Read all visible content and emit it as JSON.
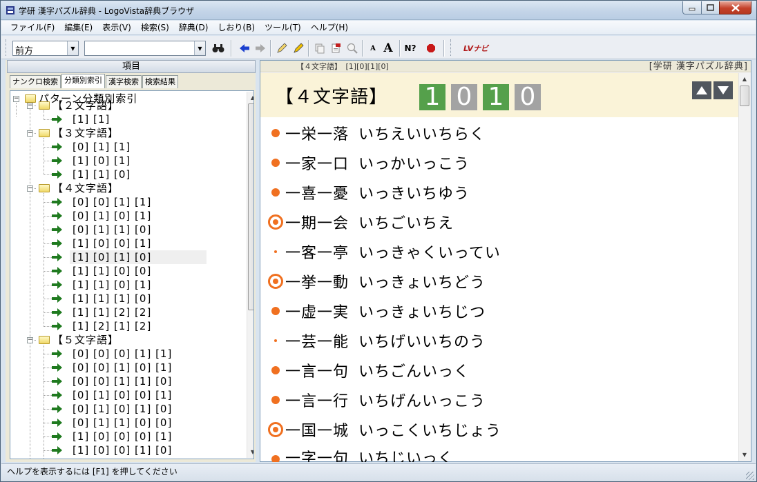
{
  "window": {
    "title": "学研 漢字パズル辞典 - LogoVista辞典ブラウザ"
  },
  "menu": [
    "ファイル(F)",
    "編集(E)",
    "表示(V)",
    "検索(S)",
    "辞典(D)",
    "しおり(B)",
    "ツール(T)",
    "ヘルプ(H)"
  ],
  "toolbar": {
    "search_mode": "前方",
    "search_input": "",
    "icons": [
      "binoculars-icon",
      "back-arrow-icon",
      "forward-arrow-icon",
      "pencil-icon",
      "highlighter-icon",
      "copy-icon",
      "cut-icon",
      "zoom-icon",
      "font-small-icon",
      "font-large-icon",
      "help-cursor-icon",
      "stop-icon",
      "lv-navi-icon"
    ],
    "font_small": "A",
    "font_large": "A",
    "help": "N?",
    "lv_navi": "LVナビ"
  },
  "left_panel": {
    "header": "項目",
    "tabs": [
      "ナンクロ検索",
      "分類別索引",
      "漢字検索",
      "検索結果"
    ],
    "active_tab": 1,
    "tree": {
      "root": "パターン分類別索引",
      "groups": [
        {
          "label": "【２文字語】",
          "items": [
            "[1]  [1]"
          ]
        },
        {
          "label": "【３文字語】",
          "items": [
            "[0]  [1]  [1]",
            "[1]  [0]  [1]",
            "[1]  [1]  [0]"
          ]
        },
        {
          "label": "【４文字語】",
          "items": [
            "[0]  [0]  [1]  [1]",
            "[0]  [1]  [0]  [1]",
            "[0]  [1]  [1]  [0]",
            "[1]  [0]  [0]  [1]",
            "[1]  [0]  [1]  [0]",
            "[1]  [1]  [0]  [0]",
            "[1]  [1]  [0]  [1]",
            "[1]  [1]  [1]  [0]",
            "[1]  [1]  [2]  [2]",
            "[1]  [2]  [1]  [2]"
          ]
        },
        {
          "label": "【５文字語】",
          "items": [
            "[0]  [0]  [0]  [1]  [1]",
            "[0]  [0]  [1]  [0]  [1]",
            "[0]  [0]  [1]  [1]  [0]",
            "[0]  [1]  [0]  [0]  [1]",
            "[0]  [1]  [0]  [1]  [0]",
            "[0]  [1]  [1]  [0]  [0]",
            "[1]  [0]  [0]  [0]  [1]",
            "[1]  [0]  [0]  [1]  [0]"
          ]
        }
      ],
      "selected": "[1]  [0]  [1]  [0]"
    }
  },
  "right_panel": {
    "crumb": "【４文字語】　[1][0][1][0]",
    "dict_name": "[学研 漢字パズル辞典]",
    "entry_title": "【４文字語】",
    "digits": [
      {
        "value": "1",
        "color": "#55a04b"
      },
      {
        "value": "0",
        "color": "#a3a3a3"
      },
      {
        "value": "1",
        "color": "#55a04b"
      },
      {
        "value": "0",
        "color": "#a3a3a3"
      }
    ],
    "entries": [
      {
        "mark": "dot",
        "word": "一栄一落",
        "reading": "いちえいいちらく"
      },
      {
        "mark": "dot",
        "word": "一家一口",
        "reading": "いっかいっこう"
      },
      {
        "mark": "dot",
        "word": "一喜一憂",
        "reading": "いっきいちゆう"
      },
      {
        "mark": "double",
        "word": "一期一会",
        "reading": "いちごいちえ"
      },
      {
        "mark": "small",
        "word": "一客一亭",
        "reading": "いっきゃくいってい"
      },
      {
        "mark": "double",
        "word": "一挙一動",
        "reading": "いっきょいちどう"
      },
      {
        "mark": "dot",
        "word": "一虚一実",
        "reading": "いっきょいちじつ"
      },
      {
        "mark": "small",
        "word": "一芸一能",
        "reading": "いちげいいちのう"
      },
      {
        "mark": "dot",
        "word": "一言一句",
        "reading": "いちごんいっく"
      },
      {
        "mark": "dot",
        "word": "一言一行",
        "reading": "いちげんいっこう"
      },
      {
        "mark": "double",
        "word": "一国一城",
        "reading": "いっこくいちじょう"
      },
      {
        "mark": "dot",
        "word": "一字一句",
        "reading": "いちじいっく"
      }
    ]
  },
  "status": {
    "text": "ヘルプを表示するには [F1] を押してください"
  },
  "colors": {
    "accent_orange": "#f07020",
    "header_bg": "#faf3d8"
  }
}
